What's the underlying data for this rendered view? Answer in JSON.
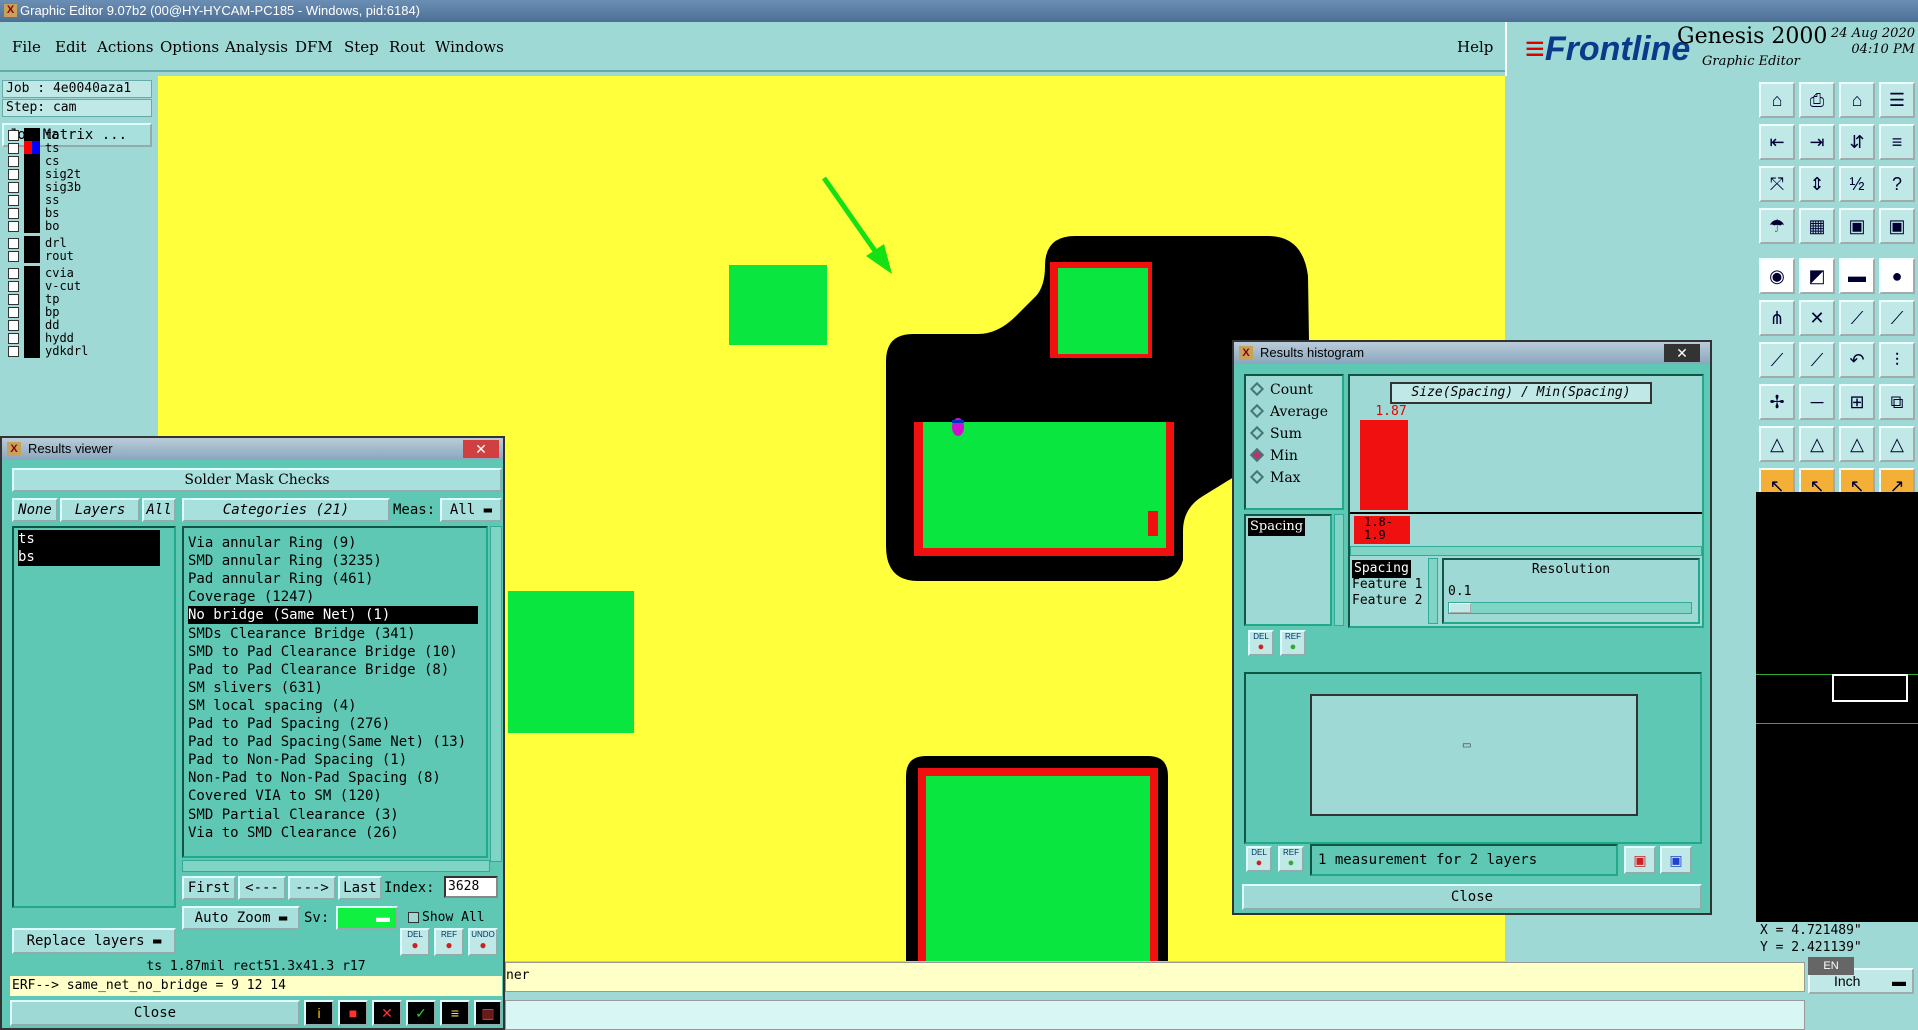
{
  "window": {
    "title": "Graphic Editor 9.07b2 (00@HY-HYCAM-PC185 - Windows, pid:6184)"
  },
  "menu": {
    "items": [
      "File",
      "Edit",
      "Actions",
      "Options",
      "Analysis",
      "DFM",
      "Step",
      "Rout",
      "Windows"
    ],
    "help": "Help"
  },
  "brand": {
    "logo": "Frontline",
    "product": "Genesis 2000",
    "subtitle": "Graphic Editor",
    "date": "24 Aug 2020",
    "time": "04:10 PM"
  },
  "job": {
    "job_line": "Job : 4e0040aza1",
    "step_line": "Step: cam",
    "matrix_button": "Job Matrix ..."
  },
  "layers": [
    {
      "name": "to",
      "color": "#ffffff",
      "sel": false
    },
    {
      "name": "ts",
      "color": "#1ea878",
      "sel": true
    },
    {
      "name": "cs",
      "color": "#f4b036",
      "sel": false
    },
    {
      "name": "sig2t",
      "color": "#f4b036",
      "sel": false
    },
    {
      "name": "sig3b",
      "color": "#f4b036",
      "sel": false
    },
    {
      "name": "ss",
      "color": "#f4b036",
      "sel": false
    },
    {
      "name": "bs",
      "color": "#1ea878",
      "sel": false
    },
    {
      "name": "bo",
      "color": "#ffffff",
      "sel": false
    },
    {
      "name": "drl",
      "color": "#d8d8d8",
      "sel": false
    },
    {
      "name": "rout",
      "color": "#d8d8d8",
      "sel": false
    },
    {
      "name": "cvia",
      "color": "#bfe8e6",
      "sel": false
    },
    {
      "name": "v-cut",
      "color": "#bfe8e6",
      "sel": false
    },
    {
      "name": "tp",
      "color": "#bfe8e6",
      "sel": false
    },
    {
      "name": "bp",
      "color": "#bfe8e6",
      "sel": false
    },
    {
      "name": "dd",
      "color": "#bfe8e6",
      "sel": false
    },
    {
      "name": "hydd",
      "color": "#bfe8e6",
      "sel": false
    },
    {
      "name": "ydkdrl",
      "color": "#bfe8e6",
      "sel": false
    }
  ],
  "results_viewer": {
    "title": "Results viewer",
    "header": "Solder Mask Checks",
    "none_btn": "None",
    "layers_btn": "Layers",
    "all_btn": "All",
    "layer_list": [
      "ts",
      "bs"
    ],
    "categories_btn": "Categories (21)",
    "meas_label": "Meas:",
    "meas_value": "All",
    "categories": [
      "Via annular Ring (9)",
      "SMD annular Ring (3235)",
      "Pad annular Ring (461)",
      "Coverage (1247)",
      "No bridge (Same Net) (1)",
      "SMDs Clearance Bridge (341)",
      "SMD to Pad Clearance Bridge (10)",
      "Pad to Pad Clearance Bridge (8)",
      "SM slivers (631)",
      "SM local spacing (4)",
      "Pad to Pad Spacing (276)",
      "Pad to Pad Spacing(Same Net) (13)",
      "Pad to Non-Pad Spacing (1)",
      "Non-Pad to Non-Pad Spacing (8)",
      "Covered VIA to SM (120)",
      "SMD Partial Clearance (3)",
      "Via to SMD Clearance (26)"
    ],
    "selected_index": 4,
    "nav": {
      "first": "First",
      "prev": "<---",
      "next": "--->",
      "last": "Last",
      "index_label": "Index:",
      "index_value": "3628"
    },
    "auto_zoom": "Auto Zoom",
    "sv_label": "Sv:",
    "show_all": "Show All",
    "replace_layers": "Replace layers",
    "icons": [
      "DEL",
      "REF",
      "UNDO"
    ],
    "status": "ts 1.87mil  rect51.3x41.3  r17",
    "erf": "ERF--> same_net_no_bridge = 9 12 14",
    "close": "Close"
  },
  "histogram": {
    "title": "Results histogram",
    "options": [
      "Count",
      "Average",
      "Sum",
      "Min",
      "Max"
    ],
    "selected_option": "Min",
    "measure_list": [
      "Spacing"
    ],
    "chart_title": "Size(Spacing) / Min(Spacing)",
    "bar_value": "1.87",
    "bar_range": "1.8-1.9",
    "attr_list": [
      "Spacing",
      "Feature 1",
      "Feature 2"
    ],
    "resolution_label": "Resolution",
    "resolution_value": "0.1",
    "summary": "1 measurement for 2 layers",
    "icons": [
      "DEL",
      "REF"
    ],
    "close": "Close"
  },
  "coords": {
    "x": "X = 4.721489\"",
    "y": "Y = 2.421139\""
  },
  "units": "Inch",
  "bottom_text": "ner",
  "lang": "EN"
}
